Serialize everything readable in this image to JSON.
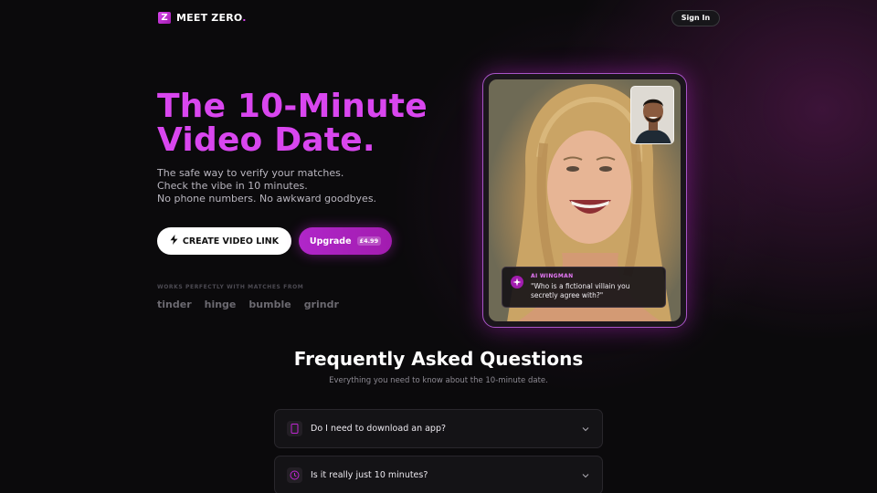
{
  "header": {
    "logo_mark": "Z",
    "logo_text": "MEET ZERO",
    "logo_dot": ".",
    "signin_label": "Sign In"
  },
  "hero": {
    "title_line1": "The 10-Minute",
    "title_line2": "Video Date.",
    "sub_lines": [
      "The safe way to verify your matches.",
      "Check the vibe in 10 minutes.",
      "No phone numbers. No awkward goodbyes."
    ],
    "create_label": "CREATE VIDEO LINK",
    "upgrade_label": "Upgrade",
    "upgrade_price": "£4.99",
    "works_label": "WORKS PERFECTLY WITH MATCHES FROM",
    "brands": [
      "tinder",
      "hinge",
      "bumble",
      "grindr"
    ]
  },
  "video": {
    "wingman_label": "AI WINGMAN",
    "wingman_text": "\"Who is a fictional villain you secretly agree with?\""
  },
  "faq": {
    "title": "Frequently Asked Questions",
    "subtitle": "Everything you need to know about the 10-minute date.",
    "items": [
      {
        "question": "Do I need to download an app?",
        "icon": "phone-icon"
      },
      {
        "question": "Is it really just 10 minutes?",
        "icon": "clock-icon"
      }
    ]
  },
  "colors": {
    "accent": "#d946ef",
    "accent_dark": "#a21caf",
    "background": "#0b0a0c"
  }
}
